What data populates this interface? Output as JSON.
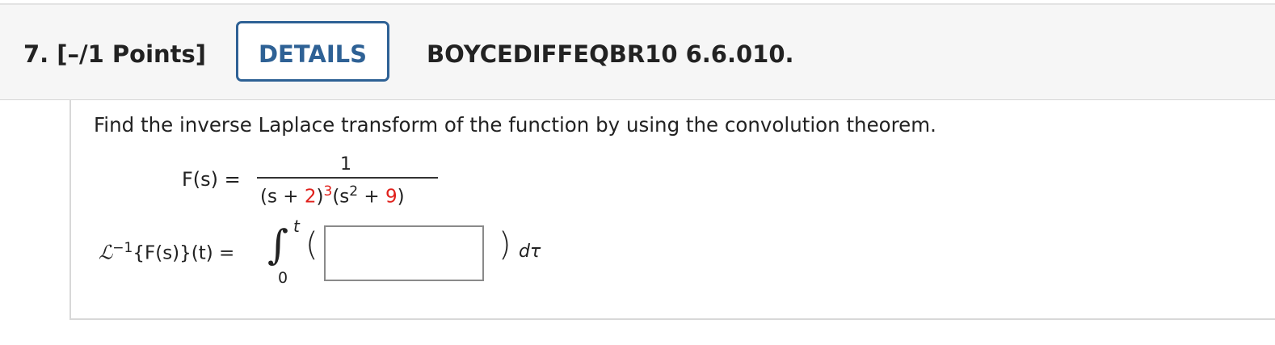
{
  "header": {
    "question_label": "7.  [–/1 Points]",
    "details_label": "DETAILS",
    "question_id": "BOYCEDIFFEQBR10 6.6.010."
  },
  "problem": {
    "prompt": "Find the inverse Laplace transform of the function by using the convolution theorem.",
    "function_label": "F(s) =",
    "numerator": "1",
    "den_open": "(s + ",
    "den_a": "2",
    "den_close_exp": ")",
    "den_exp": "3",
    "den_s": "(s",
    "den_s_exp": "2",
    "den_plus": " + ",
    "den_b": "9",
    "den_end": ")",
    "inverse_symbol": "ℒ",
    "inverse_exp": "−1",
    "inverse_rest": "{F(s)}(t) =",
    "integral_sign": "∫",
    "upper_limit": "t",
    "lower_limit": "0",
    "left_paren": "(",
    "right_paren": ")",
    "answer_value": "",
    "differential": "dτ"
  }
}
